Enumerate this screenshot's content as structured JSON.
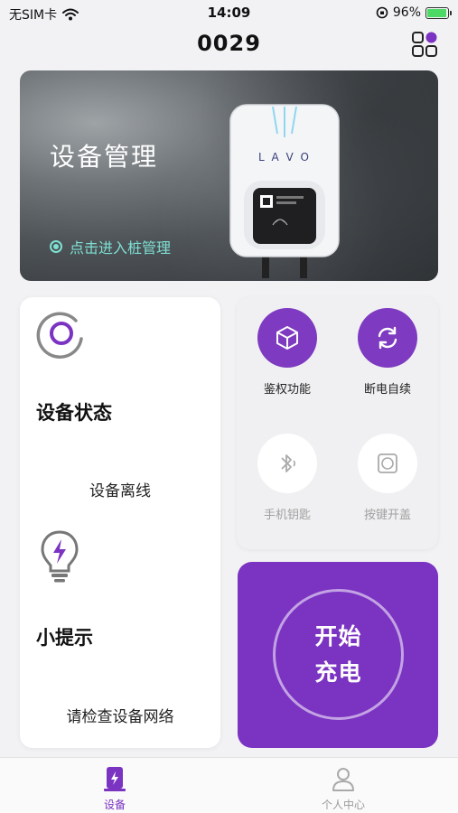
{
  "status_bar": {
    "carrier": "无SIM卡",
    "time": "14:09",
    "battery": "96%",
    "battery_level": 0.96
  },
  "header": {
    "title": "0029"
  },
  "banner": {
    "title": "设备管理",
    "link_label": "点击进入桩管理",
    "device_brand": "L A V O"
  },
  "status_card": {
    "title": "设备状态",
    "status_value": "设备离线",
    "tip_title": "小提示",
    "tip_value": "请检查设备网络"
  },
  "functions": [
    {
      "label": "鉴权功能",
      "icon": "cube-icon",
      "enabled": true
    },
    {
      "label": "断电自续",
      "icon": "refresh-icon",
      "enabled": true
    },
    {
      "label": "手机钥匙",
      "icon": "bluetooth-icon",
      "enabled": false
    },
    {
      "label": "按键开盖",
      "icon": "button-icon",
      "enabled": false
    }
  ],
  "start_button": {
    "line1": "开始",
    "line2": "充电"
  },
  "tabbar": {
    "items": [
      {
        "label": "设备",
        "icon": "charger-icon",
        "active": true
      },
      {
        "label": "个人中心",
        "icon": "person-icon",
        "active": false
      }
    ]
  },
  "colors": {
    "accent": "#7b33c2",
    "banner_link": "#7fe0d4",
    "battery_fill": "#4cd964"
  }
}
